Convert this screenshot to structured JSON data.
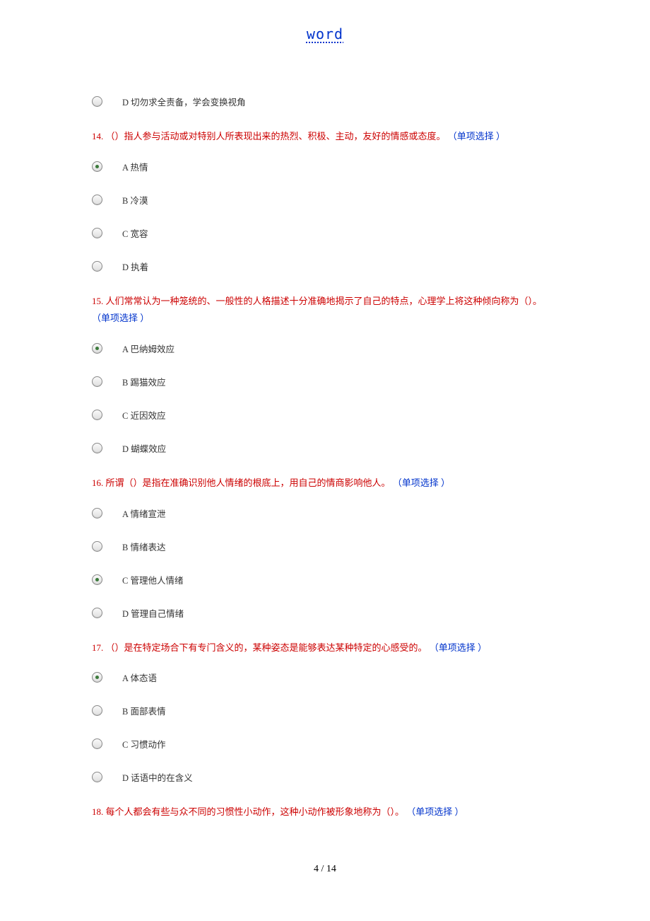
{
  "header": {
    "title": "word"
  },
  "prev_tail": {
    "option_d": "D 切勿求全责备，学会变换视角"
  },
  "q14": {
    "num": "14.",
    "body": "（）指人参与活动或对特别人所表现出来的热烈、积极、主动，友好的情感或态度。",
    "type": "（单项选择 ）",
    "a": "A 热情",
    "b": "B 冷漠",
    "c": "C 宽容",
    "d": "D 执着"
  },
  "q15": {
    "num": "15.",
    "body": "人们常常认为一种笼统的、一般性的人格描述十分准确地揭示了自己的特点，心理学上将这种倾向称为（）。",
    "type": "（单项选择 ）",
    "a": "A 巴纳姆效应",
    "b": "B 踢猫效应",
    "c": "C 近因效应",
    "d": "D 蝴蝶效应"
  },
  "q16": {
    "num": "16.",
    "body": "所谓（）是指在准确识别他人情绪的根底上，用自己的情商影响他人。",
    "type": "（单项选择 ）",
    "a": "A 情绪宣泄",
    "b": "B 情绪表达",
    "c": "C 管理他人情绪",
    "d": "D 管理自己情绪"
  },
  "q17": {
    "num": "17.",
    "body": "（）是在特定场合下有专门含义的，某种姿态是能够表达某种特定的心感受的。",
    "type": "（单项选择 ）",
    "a": "A 体态语",
    "b": "B 面部表情",
    "c": "C 习惯动作",
    "d": "D 话语中的在含义"
  },
  "q18": {
    "num": "18.",
    "body": "每个人都会有些与众不同的习惯性小动作，这种小动作被形象地称为（）。",
    "type": "（单项选择 ）"
  },
  "footer": {
    "page": "4 / 14"
  }
}
